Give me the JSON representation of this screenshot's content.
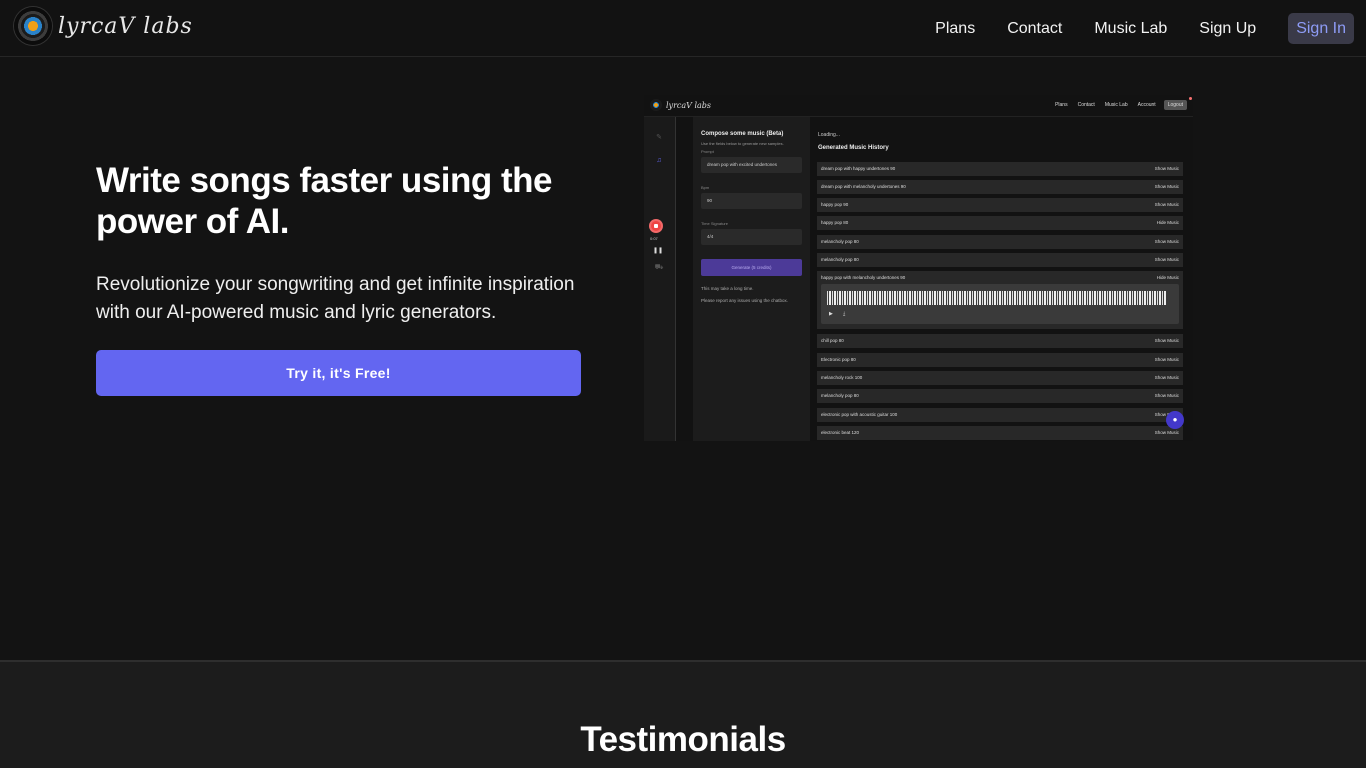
{
  "nav": {
    "logo_text": "lyrcaV labs",
    "links": [
      "Plans",
      "Contact",
      "Music Lab",
      "Sign Up"
    ],
    "signin": "Sign In"
  },
  "hero": {
    "title": "Write songs faster using the power of AI.",
    "subtitle": "Revolutionize your songwriting and get infinite inspiration with our AI-powered music and lyric generators.",
    "cta": "Try it, it's Free!"
  },
  "screenshot": {
    "logo_text": "lyrcaV labs",
    "nav_links": [
      "Plans",
      "Contact",
      "Music Lab",
      "Account"
    ],
    "logout": "Logout",
    "record_time": "0:07",
    "form": {
      "title": "Compose some music (Beta)",
      "desc": "Use the fields below to generate new samples.",
      "prompt_label": "Prompt",
      "prompt_value": "dream pop with excited undertones",
      "bpm_label": "Bpm",
      "bpm_value": "90",
      "sig_label": "Time Signature",
      "sig_value": "4/4",
      "generate": "Generate (5 credits)",
      "note1": "This may take a long time.",
      "note2": "Please report any issues using the chatbox."
    },
    "loading": "Loading...",
    "history_title": "Generated Music History",
    "history": [
      {
        "name": "dream pop with happy undertones 90",
        "action": "Show Music"
      },
      {
        "name": "dream pop with melancholy undertones 90",
        "action": "Show Music"
      },
      {
        "name": "happy pop 90",
        "action": "Show Music"
      },
      {
        "name": "happy pop 80",
        "action": "Hide Music"
      },
      {
        "name": "melancholy pop 80",
        "action": "Show Music"
      },
      {
        "name": "melancholy pop 80",
        "action": "Show Music"
      },
      {
        "name": "happy pop with melancholy undertones 90",
        "action": "Hide Music"
      },
      {
        "name": "chill pop 80",
        "action": "Show Music"
      },
      {
        "name": "Electronic pop 80",
        "action": "Show Music"
      },
      {
        "name": "melancholy rock 100",
        "action": "Show Music"
      },
      {
        "name": "melancholy pop 80",
        "action": "Show Music"
      },
      {
        "name": "electronic pop with acoustic guitar 100",
        "action": "Show Music"
      },
      {
        "name": "electronic beat 120",
        "action": "Show Music"
      }
    ]
  },
  "testimonials": {
    "title": "Testimonials"
  }
}
